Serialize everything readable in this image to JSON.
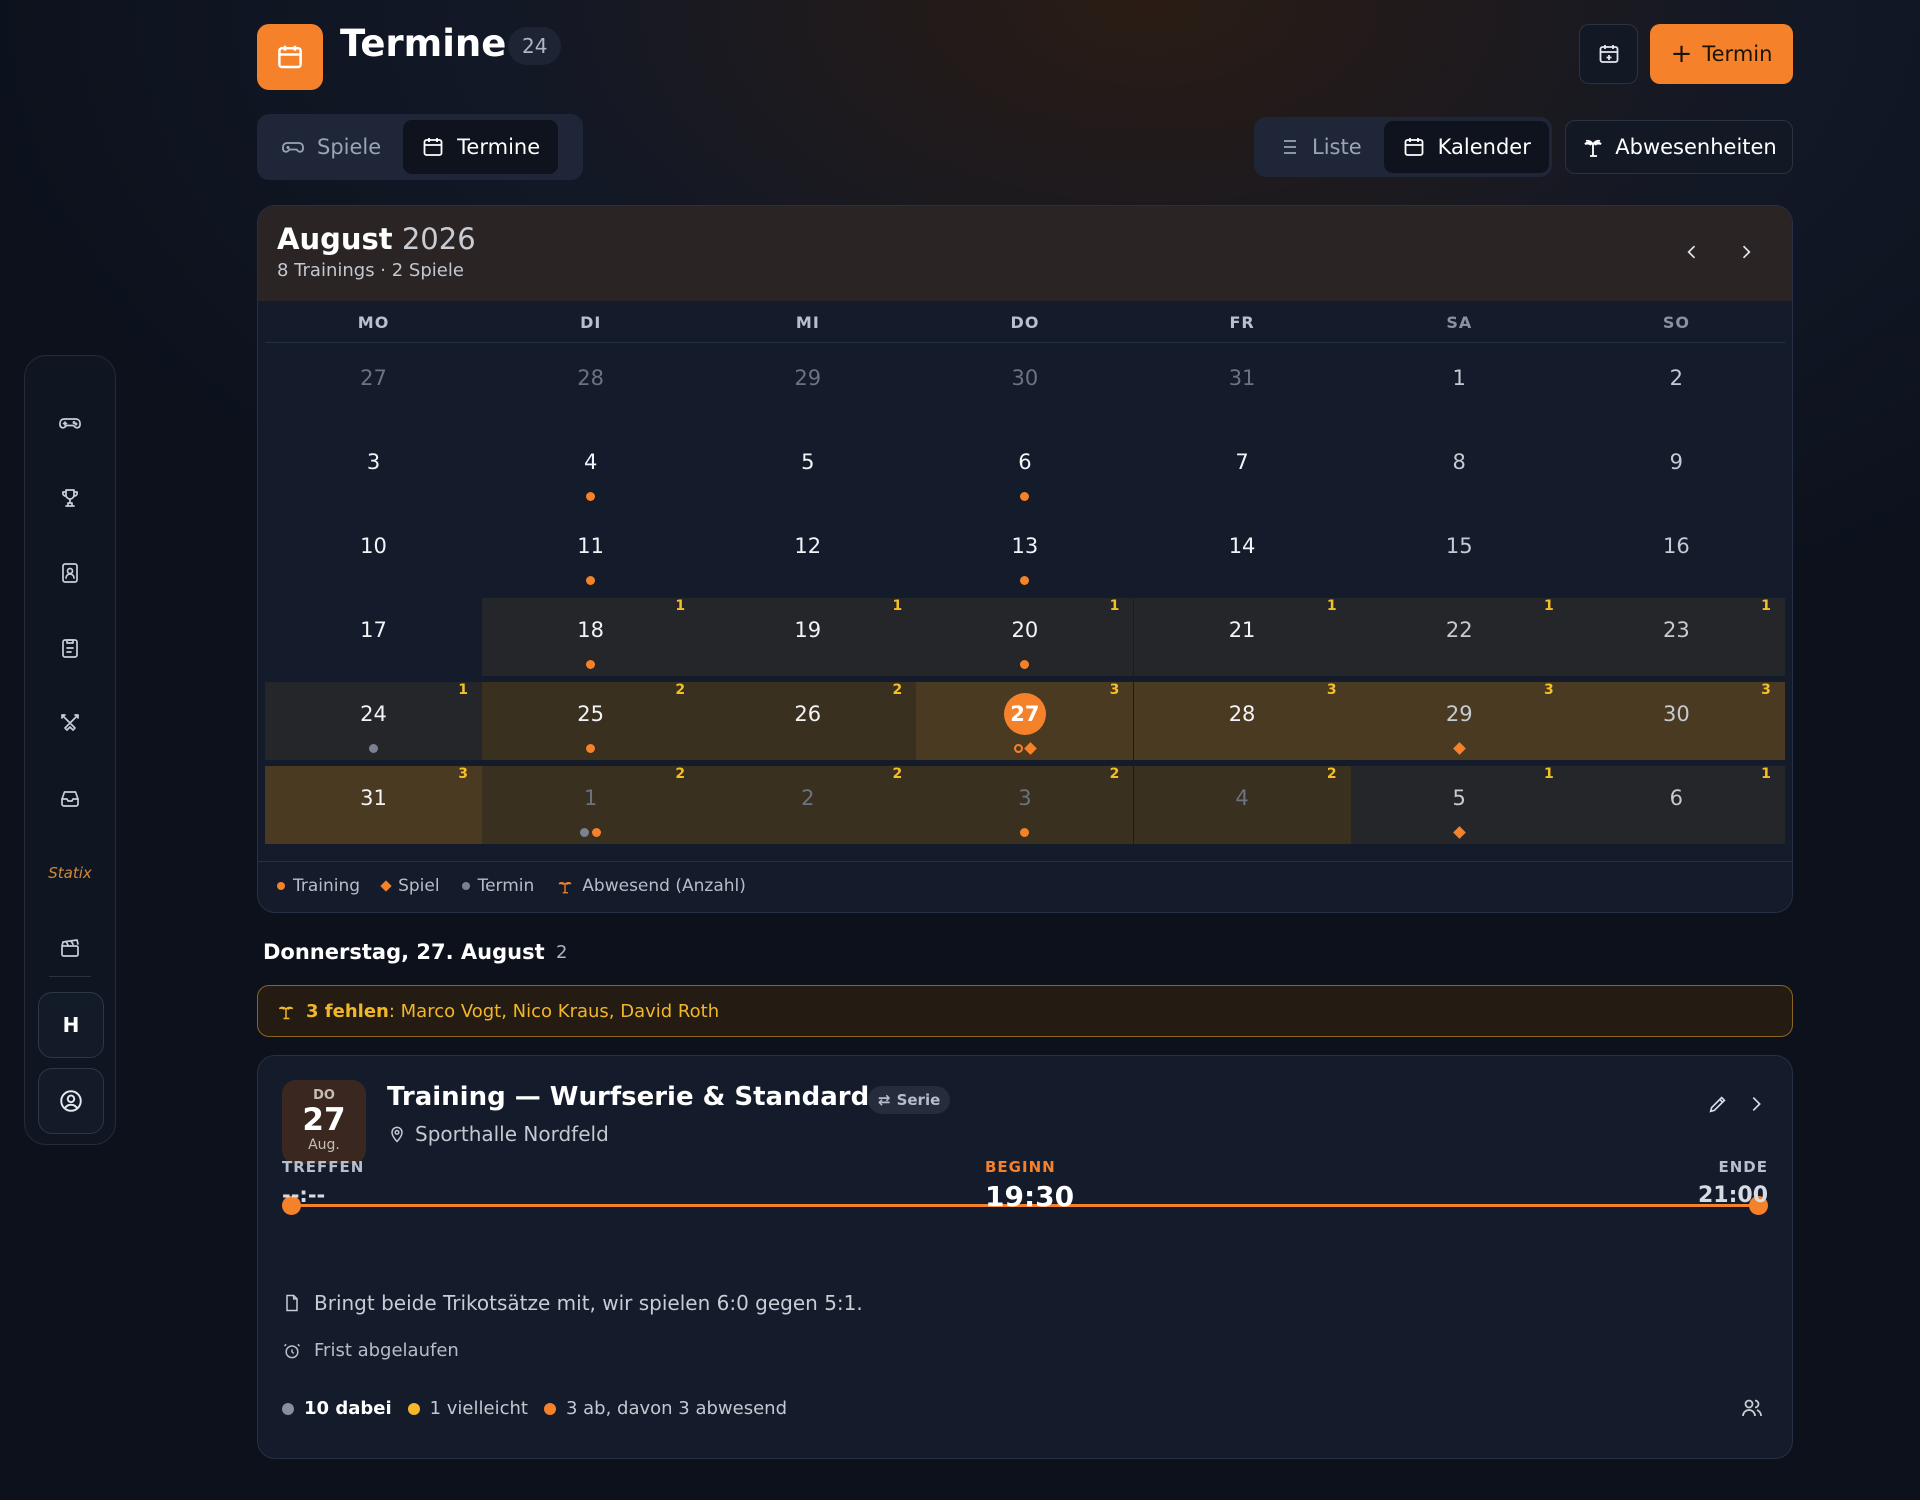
{
  "header": {
    "title": "Termine",
    "count": "24",
    "add_button": "Termin",
    "accent": "#f5822a"
  },
  "sidebar": {
    "items": [
      {
        "icon": "gamepad-icon"
      },
      {
        "icon": "trophy-icon"
      },
      {
        "icon": "contact-card-icon"
      },
      {
        "icon": "clipboard-icon"
      },
      {
        "icon": "swords-icon"
      },
      {
        "icon": "inbox-icon"
      },
      {
        "label": "Statix"
      },
      {
        "icon": "clapperboard-icon"
      }
    ],
    "team_initial": "H"
  },
  "tabs": [
    {
      "label": "Spiele",
      "icon": "gamepad-icon",
      "active": false
    },
    {
      "label": "Termine",
      "icon": "calendar-icon",
      "active": true
    }
  ],
  "views": [
    {
      "label": "Liste",
      "icon": "list-icon",
      "active": false
    },
    {
      "label": "Kalender",
      "icon": "calendar-icon",
      "active": true
    }
  ],
  "absences_button": "Abwesenheiten",
  "calendar": {
    "month": "August",
    "year": "2026",
    "summary": "8 Trainings · 2 Spiele",
    "weekdays": [
      "MO",
      "DI",
      "MI",
      "DO",
      "FR",
      "SA",
      "SO"
    ],
    "weeks": [
      [
        {
          "day": "27",
          "out": true
        },
        {
          "day": "28",
          "out": true
        },
        {
          "day": "29",
          "out": true
        },
        {
          "day": "30",
          "out": true
        },
        {
          "day": "31",
          "out": true
        },
        {
          "day": "1"
        },
        {
          "day": "2"
        }
      ],
      [
        {
          "day": "3"
        },
        {
          "day": "4",
          "marks": [
            "training"
          ]
        },
        {
          "day": "5"
        },
        {
          "day": "6",
          "marks": [
            "training"
          ]
        },
        {
          "day": "7"
        },
        {
          "day": "8"
        },
        {
          "day": "9"
        }
      ],
      [
        {
          "day": "10"
        },
        {
          "day": "11",
          "marks": [
            "training"
          ]
        },
        {
          "day": "12"
        },
        {
          "day": "13",
          "marks": [
            "training"
          ]
        },
        {
          "day": "14"
        },
        {
          "day": "15"
        },
        {
          "day": "16"
        }
      ],
      [
        {
          "day": "17"
        },
        {
          "day": "18",
          "absent": "1",
          "level": 1,
          "marks": [
            "training"
          ]
        },
        {
          "day": "19",
          "absent": "1",
          "level": 1
        },
        {
          "day": "20",
          "absent": "1",
          "level": 1,
          "marks": [
            "training"
          ]
        },
        {
          "day": "21",
          "absent": "1",
          "level": 1
        },
        {
          "day": "22",
          "absent": "1",
          "level": 1
        },
        {
          "day": "23",
          "absent": "1",
          "level": 1
        }
      ],
      [
        {
          "day": "24",
          "absent": "1",
          "level": 1,
          "marks": [
            "termin"
          ]
        },
        {
          "day": "25",
          "absent": "2",
          "level": 2,
          "marks": [
            "training"
          ]
        },
        {
          "day": "26",
          "absent": "2",
          "level": 2
        },
        {
          "day": "27",
          "absent": "3",
          "level": 3,
          "today": true,
          "marks": [
            "training-ring",
            "spiel"
          ]
        },
        {
          "day": "28",
          "absent": "3",
          "level": 3
        },
        {
          "day": "29",
          "absent": "3",
          "level": 3,
          "marks": [
            "spiel"
          ]
        },
        {
          "day": "30",
          "absent": "3",
          "level": 3
        }
      ],
      [
        {
          "day": "31",
          "absent": "3",
          "level": 3
        },
        {
          "day": "1",
          "out": true,
          "absent": "2",
          "level": 2,
          "marks": [
            "termin",
            "training"
          ]
        },
        {
          "day": "2",
          "out": true,
          "absent": "2",
          "level": 2
        },
        {
          "day": "3",
          "out": true,
          "absent": "2",
          "level": 2,
          "marks": [
            "training"
          ]
        },
        {
          "day": "4",
          "out": true,
          "absent": "2",
          "level": 2
        },
        {
          "day": "5",
          "out": true,
          "absent": "1",
          "level": 1,
          "marks": [
            "spiel"
          ]
        },
        {
          "day": "6",
          "out": true,
          "absent": "1",
          "level": 1
        }
      ]
    ],
    "legend": {
      "training": "Training",
      "spiel": "Spiel",
      "termin": "Termin",
      "absent": "Abwesend (Anzahl)"
    }
  },
  "selected_day": {
    "title": "Donnerstag, 27. August",
    "count": "2",
    "absent_count": "3 fehlen",
    "absent_names": ": Marco Vogt, Nico Kraus, David Roth"
  },
  "event": {
    "weekday": "DO",
    "day": "27",
    "month": "Aug.",
    "title": "Training — Wurfserie & Standards",
    "series_tag": "Serie",
    "location": "Sporthalle Nordfeld",
    "meet_label": "TREFFEN",
    "meet_value": "--:--",
    "start_label": "BEGINN",
    "start_value": "19:30",
    "end_label": "ENDE",
    "end_value": "21:00",
    "note": "Bringt beide Trikotsätze mit, wir spielen 6:0 gegen 5:1.",
    "deadline": "Frist abgelaufen",
    "rsvp_yes": "10 dabei",
    "rsvp_maybe": "1 vielleicht",
    "rsvp_no": "3 ab, davon 3 abwesend",
    "colors": {
      "yes": "#8a8f99",
      "maybe": "#f5b82a",
      "no": "#f5822a"
    }
  }
}
